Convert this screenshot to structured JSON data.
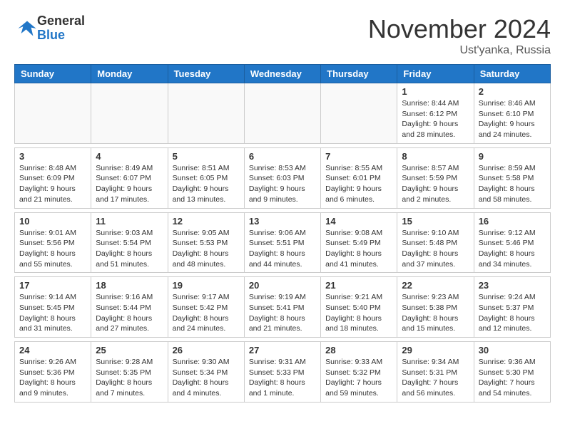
{
  "header": {
    "logo_general": "General",
    "logo_blue": "Blue",
    "month_title": "November 2024",
    "location": "Ust'yanka, Russia"
  },
  "days_of_week": [
    "Sunday",
    "Monday",
    "Tuesday",
    "Wednesday",
    "Thursday",
    "Friday",
    "Saturday"
  ],
  "weeks": [
    [
      {
        "day": "",
        "info": ""
      },
      {
        "day": "",
        "info": ""
      },
      {
        "day": "",
        "info": ""
      },
      {
        "day": "",
        "info": ""
      },
      {
        "day": "",
        "info": ""
      },
      {
        "day": "1",
        "info": "Sunrise: 8:44 AM\nSunset: 6:12 PM\nDaylight: 9 hours and 28 minutes."
      },
      {
        "day": "2",
        "info": "Sunrise: 8:46 AM\nSunset: 6:10 PM\nDaylight: 9 hours and 24 minutes."
      }
    ],
    [
      {
        "day": "3",
        "info": "Sunrise: 8:48 AM\nSunset: 6:09 PM\nDaylight: 9 hours and 21 minutes."
      },
      {
        "day": "4",
        "info": "Sunrise: 8:49 AM\nSunset: 6:07 PM\nDaylight: 9 hours and 17 minutes."
      },
      {
        "day": "5",
        "info": "Sunrise: 8:51 AM\nSunset: 6:05 PM\nDaylight: 9 hours and 13 minutes."
      },
      {
        "day": "6",
        "info": "Sunrise: 8:53 AM\nSunset: 6:03 PM\nDaylight: 9 hours and 9 minutes."
      },
      {
        "day": "7",
        "info": "Sunrise: 8:55 AM\nSunset: 6:01 PM\nDaylight: 9 hours and 6 minutes."
      },
      {
        "day": "8",
        "info": "Sunrise: 8:57 AM\nSunset: 5:59 PM\nDaylight: 9 hours and 2 minutes."
      },
      {
        "day": "9",
        "info": "Sunrise: 8:59 AM\nSunset: 5:58 PM\nDaylight: 8 hours and 58 minutes."
      }
    ],
    [
      {
        "day": "10",
        "info": "Sunrise: 9:01 AM\nSunset: 5:56 PM\nDaylight: 8 hours and 55 minutes."
      },
      {
        "day": "11",
        "info": "Sunrise: 9:03 AM\nSunset: 5:54 PM\nDaylight: 8 hours and 51 minutes."
      },
      {
        "day": "12",
        "info": "Sunrise: 9:05 AM\nSunset: 5:53 PM\nDaylight: 8 hours and 48 minutes."
      },
      {
        "day": "13",
        "info": "Sunrise: 9:06 AM\nSunset: 5:51 PM\nDaylight: 8 hours and 44 minutes."
      },
      {
        "day": "14",
        "info": "Sunrise: 9:08 AM\nSunset: 5:49 PM\nDaylight: 8 hours and 41 minutes."
      },
      {
        "day": "15",
        "info": "Sunrise: 9:10 AM\nSunset: 5:48 PM\nDaylight: 8 hours and 37 minutes."
      },
      {
        "day": "16",
        "info": "Sunrise: 9:12 AM\nSunset: 5:46 PM\nDaylight: 8 hours and 34 minutes."
      }
    ],
    [
      {
        "day": "17",
        "info": "Sunrise: 9:14 AM\nSunset: 5:45 PM\nDaylight: 8 hours and 31 minutes."
      },
      {
        "day": "18",
        "info": "Sunrise: 9:16 AM\nSunset: 5:44 PM\nDaylight: 8 hours and 27 minutes."
      },
      {
        "day": "19",
        "info": "Sunrise: 9:17 AM\nSunset: 5:42 PM\nDaylight: 8 hours and 24 minutes."
      },
      {
        "day": "20",
        "info": "Sunrise: 9:19 AM\nSunset: 5:41 PM\nDaylight: 8 hours and 21 minutes."
      },
      {
        "day": "21",
        "info": "Sunrise: 9:21 AM\nSunset: 5:40 PM\nDaylight: 8 hours and 18 minutes."
      },
      {
        "day": "22",
        "info": "Sunrise: 9:23 AM\nSunset: 5:38 PM\nDaylight: 8 hours and 15 minutes."
      },
      {
        "day": "23",
        "info": "Sunrise: 9:24 AM\nSunset: 5:37 PM\nDaylight: 8 hours and 12 minutes."
      }
    ],
    [
      {
        "day": "24",
        "info": "Sunrise: 9:26 AM\nSunset: 5:36 PM\nDaylight: 8 hours and 9 minutes."
      },
      {
        "day": "25",
        "info": "Sunrise: 9:28 AM\nSunset: 5:35 PM\nDaylight: 8 hours and 7 minutes."
      },
      {
        "day": "26",
        "info": "Sunrise: 9:30 AM\nSunset: 5:34 PM\nDaylight: 8 hours and 4 minutes."
      },
      {
        "day": "27",
        "info": "Sunrise: 9:31 AM\nSunset: 5:33 PM\nDaylight: 8 hours and 1 minute."
      },
      {
        "day": "28",
        "info": "Sunrise: 9:33 AM\nSunset: 5:32 PM\nDaylight: 7 hours and 59 minutes."
      },
      {
        "day": "29",
        "info": "Sunrise: 9:34 AM\nSunset: 5:31 PM\nDaylight: 7 hours and 56 minutes."
      },
      {
        "day": "30",
        "info": "Sunrise: 9:36 AM\nSunset: 5:30 PM\nDaylight: 7 hours and 54 minutes."
      }
    ]
  ]
}
